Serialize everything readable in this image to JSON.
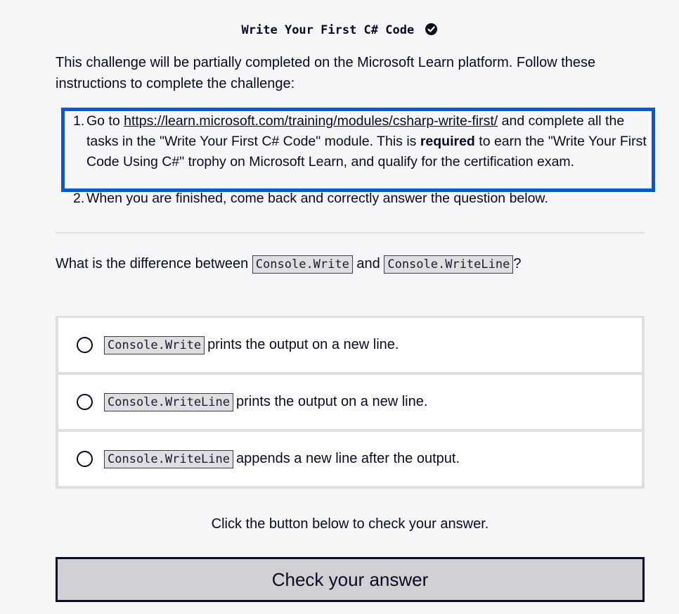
{
  "challenge": {
    "title": "Write Your First C# Code",
    "completed_icon": "check-circle-icon",
    "intro": "This challenge will be partially completed on the Microsoft Learn platform. Follow these instructions to complete the challenge:"
  },
  "steps": [
    {
      "number": "1.",
      "prefix": "Go to ",
      "link": "https://learn.microsoft.com/training/modules/csharp-write-first/",
      "middle": " and complete all the tasks in the \"Write Your First C# Code\" module. This is ",
      "emphasis": "required",
      "suffix": " to earn the \"Write Your First Code Using C#\" trophy on Microsoft Learn, and qualify for the certification exam."
    },
    {
      "number": "2.",
      "text": "When you are finished, come back and correctly answer the question below."
    }
  ],
  "question": {
    "prefix": "What is the difference between ",
    "code1": "Console.Write",
    "middle": " and ",
    "code2": "Console.WriteLine",
    "suffix": "?"
  },
  "options": [
    {
      "code": "Console.Write",
      "text": " prints the output on a new line."
    },
    {
      "code": "Console.WriteLine",
      "text": " prints the output on a new line."
    },
    {
      "code": "Console.WriteLine",
      "text": " appends a new line after the output."
    }
  ],
  "hint": "Click the button below to check your answer.",
  "button": {
    "label": "Check your answer"
  },
  "colors": {
    "focus_outline": "#0059d6",
    "text": "#0a0a23",
    "background": "#f5f6f8",
    "button_bg": "#d0d0d5"
  }
}
